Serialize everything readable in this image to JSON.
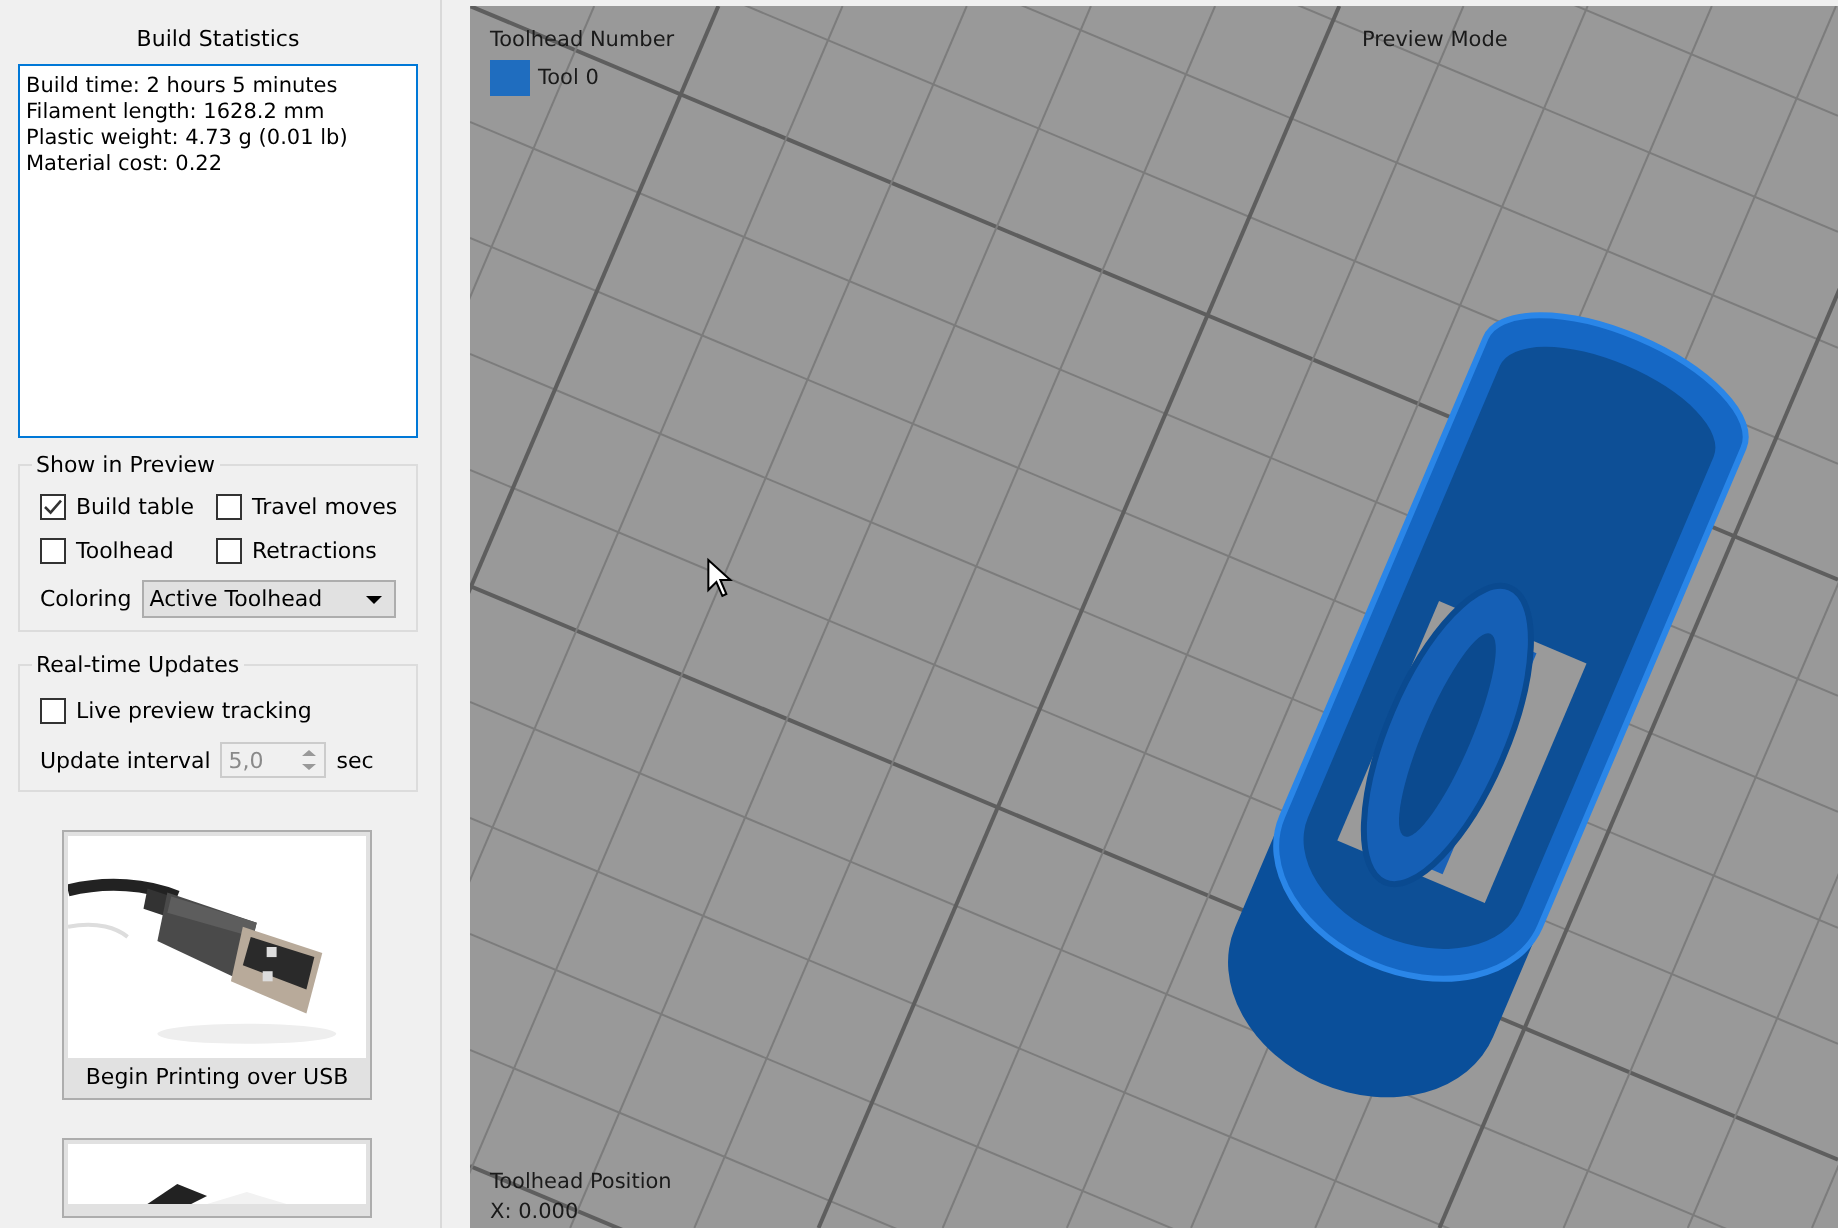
{
  "stats": {
    "title": "Build Statistics",
    "lines": [
      "Build time: 2 hours 5 minutes",
      "Filament length: 1628.2 mm",
      "Plastic weight: 4.73 g (0.01 lb)",
      "Material cost: 0.22"
    ]
  },
  "show_in_preview": {
    "title": "Show in Preview",
    "options": [
      {
        "label": "Build table",
        "checked": true
      },
      {
        "label": "Travel moves",
        "checked": false
      },
      {
        "label": "Toolhead",
        "checked": false
      },
      {
        "label": "Retractions",
        "checked": false
      }
    ],
    "coloring": {
      "label": "Coloring",
      "value": "Active Toolhead"
    }
  },
  "realtime": {
    "title": "Real-time Updates",
    "live": {
      "label": "Live preview tracking",
      "checked": false
    },
    "interval": {
      "label": "Update interval",
      "value": "5,0",
      "unit": "sec",
      "disabled": true
    }
  },
  "print_buttons": [
    {
      "kind": "usb",
      "label": "Begin Printing over USB"
    },
    {
      "kind": "partial"
    }
  ],
  "viewport": {
    "legend_title": "Toolhead Number",
    "tools": [
      {
        "label": "Tool 0",
        "color": "#1f6dbf"
      }
    ],
    "mode_label": "Preview Mode",
    "position_title": "Toolhead Position",
    "position": "X: 0.000"
  }
}
